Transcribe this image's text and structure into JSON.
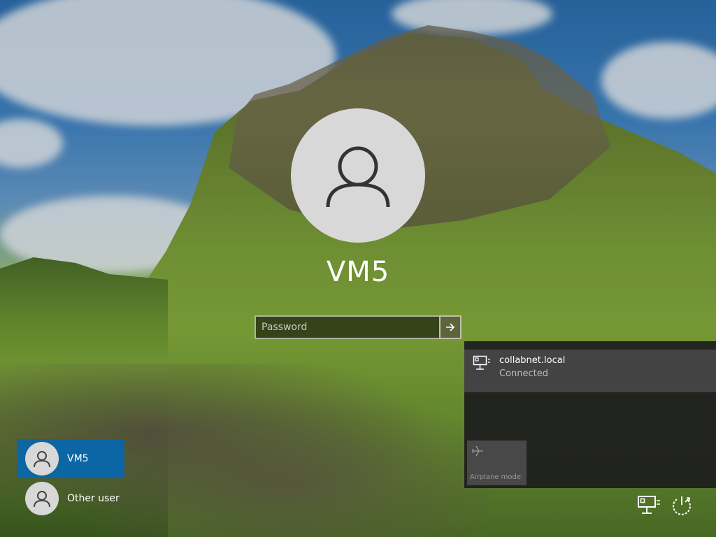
{
  "user": {
    "display_name": "VM5"
  },
  "login": {
    "password_placeholder": "Password",
    "submit_icon": "arrow-right-icon"
  },
  "user_list": [
    {
      "label": "VM5",
      "selected": true,
      "icon": "user-icon"
    },
    {
      "label": "Other user",
      "selected": false,
      "icon": "user-icon"
    }
  ],
  "network_flyout": {
    "network": {
      "name": "collabnet.local",
      "status": "Connected",
      "icon": "ethernet-icon"
    },
    "quick_actions": [
      {
        "label": "Airplane mode",
        "icon": "airplane-icon",
        "enabled": false
      }
    ]
  },
  "tray": {
    "network_icon": "ethernet-icon",
    "power_icon": "power-icon"
  },
  "colors": {
    "selected_user_bg": "#0067b8",
    "flyout_bg": "#1f1f1f",
    "network_entry_bg": "#464646"
  }
}
